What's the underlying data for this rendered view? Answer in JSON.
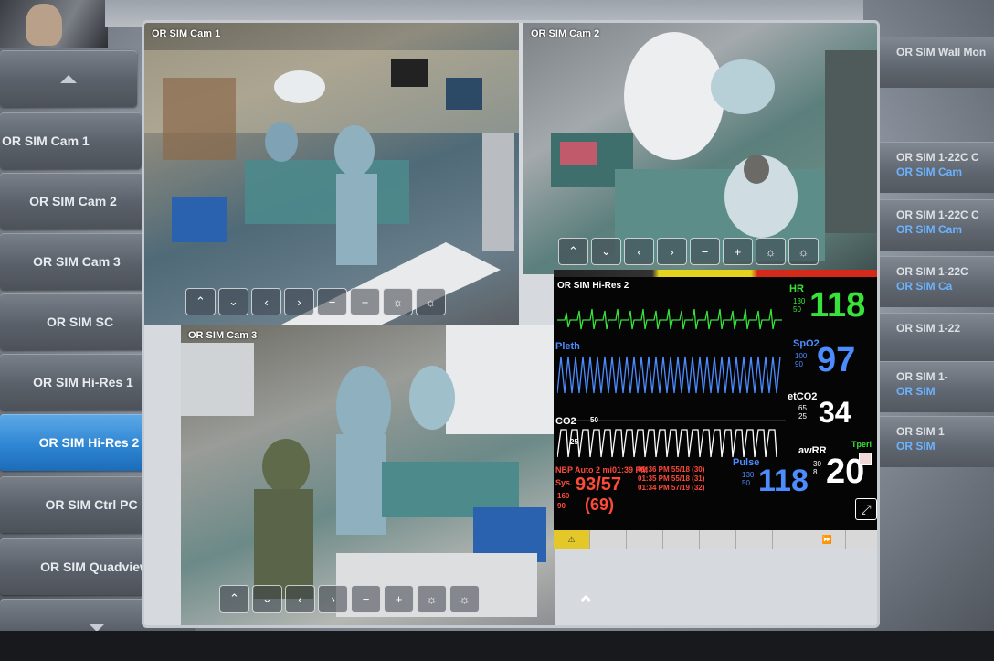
{
  "left_sidebar": {
    "items": [
      {
        "label": "OR SIM Cam 1"
      },
      {
        "label": "OR SIM Cam 2"
      },
      {
        "label": "OR SIM Cam 3"
      },
      {
        "label": "OR SIM SC"
      },
      {
        "label": "OR SIM Hi-Res 1"
      },
      {
        "label": "OR SIM Hi-Res 2"
      },
      {
        "label": "OR SIM Ctrl PC"
      },
      {
        "label": "OR SIM Quadview"
      }
    ],
    "active_item": "OR SIM Hi-Res 2"
  },
  "right_sidebar": {
    "items": [
      {
        "label": "OR SIM Wall Mon",
        "sub": ""
      },
      {
        "label": "OR SIM 1-22C C",
        "sub": "OR SIM Cam"
      },
      {
        "label": "OR SIM 1-22C C",
        "sub": "OR SIM Cam"
      },
      {
        "label": "OR SIM 1-22C",
        "sub": "OR SIM Ca"
      },
      {
        "label": "OR SIM 1-22",
        "sub": ""
      },
      {
        "label": "OR SIM 1-",
        "sub": "OR SIM"
      },
      {
        "label": "OR SIM 1",
        "sub": "OR SIM"
      }
    ]
  },
  "quadview": {
    "cams": [
      {
        "label": "OR SIM Cam 1"
      },
      {
        "label": "OR SIM Cam 2"
      },
      {
        "label": "OR SIM Cam 3"
      }
    ],
    "monitor_label": "OR SIM Hi-Res 2",
    "controls": [
      "^",
      "v",
      "<",
      ">",
      "-",
      "+",
      "☼",
      "☼"
    ]
  },
  "monitor": {
    "hr_label": "HR",
    "hr_value": "118",
    "hr_limits": [
      "130",
      "50"
    ],
    "spo2_label": "SpO2",
    "spo2_value": "97",
    "spo2_limits": [
      "100",
      "90"
    ],
    "etco2_label": "etCO2",
    "etco2_value": "34",
    "etco2_limits": [
      "65",
      "25"
    ],
    "awrr_label": "awRR",
    "awrr_value": "20",
    "awrr_limits": [
      "30",
      "8"
    ],
    "pulse_label": "Pulse",
    "pulse_value": "118",
    "pulse_limits": [
      "130",
      "50"
    ],
    "nibp_label": "NBP",
    "nibp_mode": "Auto 2 mi01:39 PM",
    "nibp_value": "93/57",
    "nibp_mean": "(69)",
    "nibp_sys": "Sys.",
    "nibp_limits": [
      "160",
      "90"
    ],
    "nibp_history": [
      "01:36 PM 55/18 (30)",
      "01:35 PM 55/18 (31)",
      "01:34 PM 57/19 (32)"
    ],
    "pleth_label": "Pleth",
    "co2_label": "CO2",
    "co2_scale": "50",
    "co2_scale_low": "25",
    "tperi_label": "Tperi",
    "colors": {
      "hr": "#38e23a",
      "spo2": "#4d8cff",
      "white": "#ffffff",
      "nibp": "#ff4a3a"
    }
  },
  "bottom_nav": {
    "up_arrow": "^"
  }
}
